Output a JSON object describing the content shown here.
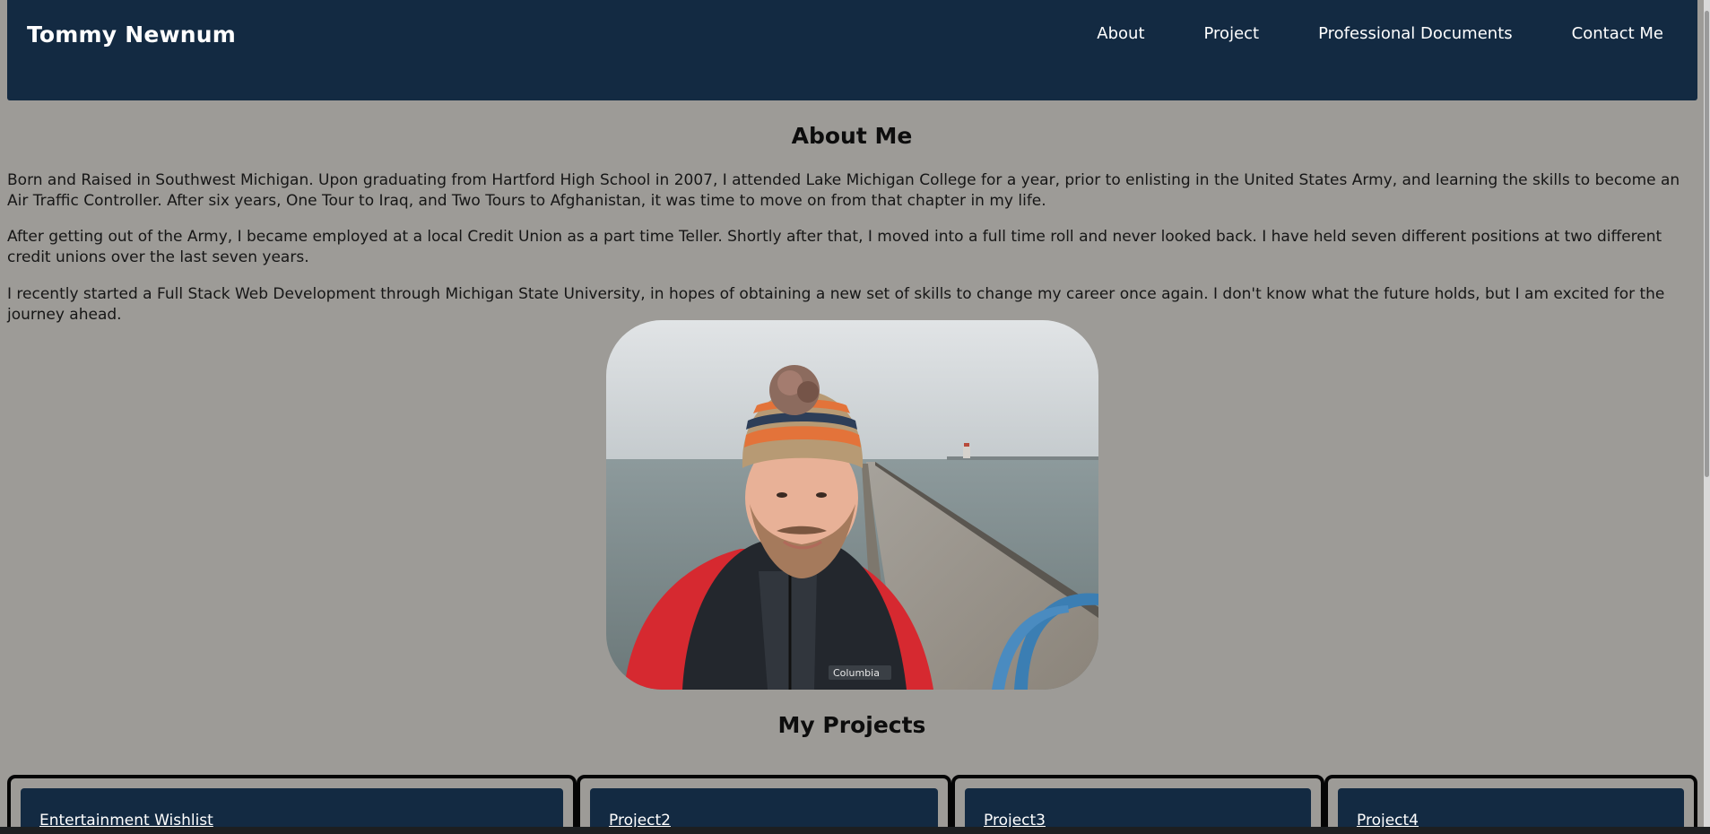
{
  "header": {
    "brand": "Tommy Newnum",
    "nav": [
      {
        "label": "About"
      },
      {
        "label": "Project"
      },
      {
        "label": "Professional Documents"
      },
      {
        "label": "Contact Me"
      }
    ]
  },
  "about": {
    "title": "About Me",
    "paragraphs": [
      "Born and Raised in Southwest Michigan. Upon graduating from Hartford High School in 2007, I attended Lake Michigan College for a year, prior to enlisting in the United States Army, and learning the skills to become an Air Traffic Controller. After six years, One Tour to Iraq, and Two Tours to Afghanistan, it was time to move on from that chapter in my life.",
      "After getting out of the Army, I became employed at a local Credit Union as a part time Teller. Shortly after that, I moved into a full time roll and never looked back. I have held seven different positions at two different credit unions over the last seven years.",
      "I recently started a Full Stack Web Development through Michigan State University, in hopes of obtaining a new set of skills to change my career once again. I don't know what the future holds, but I am excited for the journey ahead."
    ]
  },
  "projects": {
    "title": "My Projects",
    "items": [
      {
        "label": "Entertainment Wishlist"
      },
      {
        "label": "Project2"
      },
      {
        "label": "Project3"
      },
      {
        "label": "Project4"
      }
    ]
  },
  "colors": {
    "page_bg": "#9d9b97",
    "header_bg": "#132a42",
    "card_bg": "#132a42"
  }
}
